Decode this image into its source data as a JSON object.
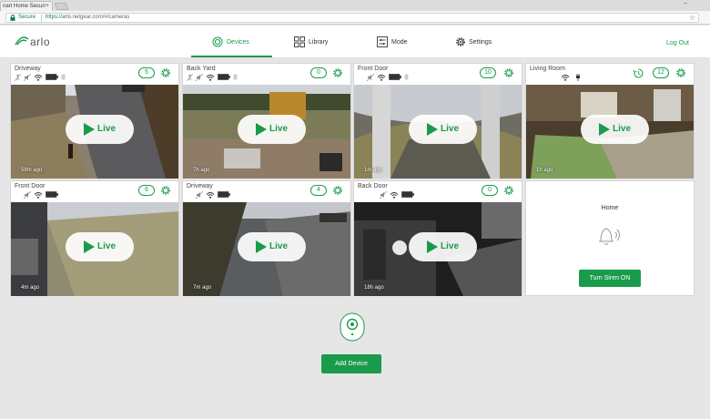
{
  "browser": {
    "tab_title": "nart Home Securi",
    "tab_close": "×",
    "minimize": "–",
    "secure_label": "Secure",
    "url_scheme": "https://",
    "url_rest": "arlo.netgear.com/#/cameras"
  },
  "header": {
    "logo_text": "arlo",
    "nav": [
      {
        "label": "Devices",
        "icon": "devices-icon",
        "active": true
      },
      {
        "label": "Library",
        "icon": "library-grid-icon",
        "active": false
      },
      {
        "label": "Mode",
        "icon": "mode-icon",
        "active": false
      },
      {
        "label": "Settings",
        "icon": "gear-icon",
        "active": false
      }
    ],
    "logout_label": "Log Out"
  },
  "cameras": [
    {
      "name": "Driveway",
      "count": "5",
      "ago": "58m ago",
      "live_label": "Live"
    },
    {
      "name": "Back Yard",
      "count": "0",
      "ago": "7h ago",
      "live_label": "Live"
    },
    {
      "name": "Front Door",
      "count": "10",
      "ago": "1m ago",
      "live_label": "Live"
    },
    {
      "name": "Living Room",
      "count": "12",
      "ago": "1h ago",
      "live_label": "Live"
    },
    {
      "name": "Front Door",
      "count": "6",
      "ago": "4m ago",
      "live_label": "Live"
    },
    {
      "name": "Driveway",
      "count": "4",
      "ago": "7m ago",
      "live_label": "Live"
    },
    {
      "name": "Back Door",
      "count": "0",
      "ago": "18h ago",
      "live_label": "Live"
    }
  ],
  "siren": {
    "mode_label": "Home",
    "button_label": "Turn Siren ON",
    "icon": "bell-siren-icon"
  },
  "add_device": {
    "button_label": "Add Device",
    "icon": "arlo-base-station-icon"
  },
  "colors": {
    "accent": "#1a9b4b",
    "background": "#e6e6e6",
    "card": "#ffffff"
  }
}
